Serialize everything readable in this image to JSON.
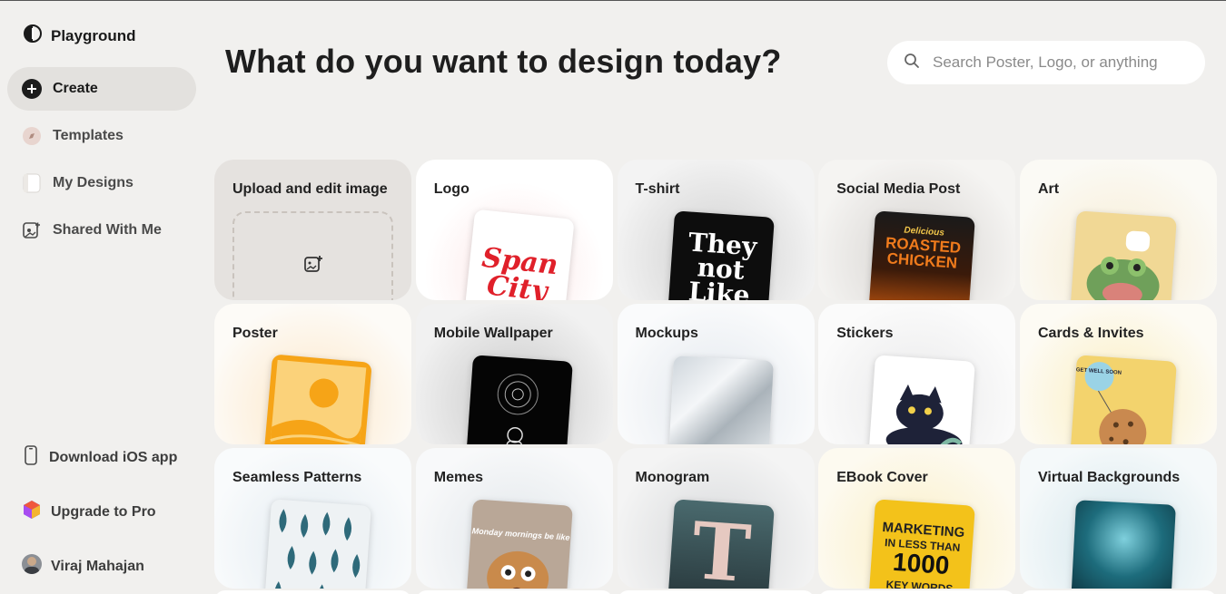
{
  "app": {
    "name": "Playground"
  },
  "nav": {
    "items": [
      {
        "label": "Create",
        "active": true,
        "icon": "plus-circle-icon"
      },
      {
        "label": "Templates",
        "active": false,
        "icon": "compass-icon"
      },
      {
        "label": "My Designs",
        "active": false,
        "icon": "folder-icon"
      },
      {
        "label": "Shared With Me",
        "active": false,
        "icon": "shared-image-icon"
      }
    ],
    "bottom": [
      {
        "label": "Download iOS app",
        "icon": "phone-icon"
      },
      {
        "label": "Upgrade to Pro",
        "icon": "pro-cube-icon"
      },
      {
        "label": "Viraj Mahajan",
        "icon": "avatar"
      }
    ]
  },
  "header": {
    "title": "What do you want to design today?",
    "search_placeholder": "Search Poster, Logo, or anything"
  },
  "categories": [
    {
      "label": "Upload and edit image"
    },
    {
      "label": "Logo",
      "thumb_text": "Span City"
    },
    {
      "label": "T-shirt",
      "thumb_text": "They not Like"
    },
    {
      "label": "Social Media Post",
      "thumb_text_small": "Delicious",
      "thumb_text": "ROASTED CHICKEN"
    },
    {
      "label": "Art"
    },
    {
      "label": "Poster"
    },
    {
      "label": "Mobile Wallpaper"
    },
    {
      "label": "Mockups"
    },
    {
      "label": "Stickers"
    },
    {
      "label": "Cards & Invites",
      "thumb_text": "GET WELL SOON"
    },
    {
      "label": "Seamless Patterns"
    },
    {
      "label": "Memes",
      "thumb_text": "Monday mornings be like"
    },
    {
      "label": "Monogram",
      "thumb_text": "T"
    },
    {
      "label": "EBook Cover",
      "thumb_text": "MARKETING",
      "thumb_text_2": "IN LESS THAN",
      "thumb_text_3": "1000",
      "thumb_text_4": "KEY WORDS"
    },
    {
      "label": "Virtual Backgrounds"
    }
  ],
  "colors": {
    "background": "#f1f0ee",
    "active_nav": "#e3e1de",
    "card": "#ffffff"
  }
}
